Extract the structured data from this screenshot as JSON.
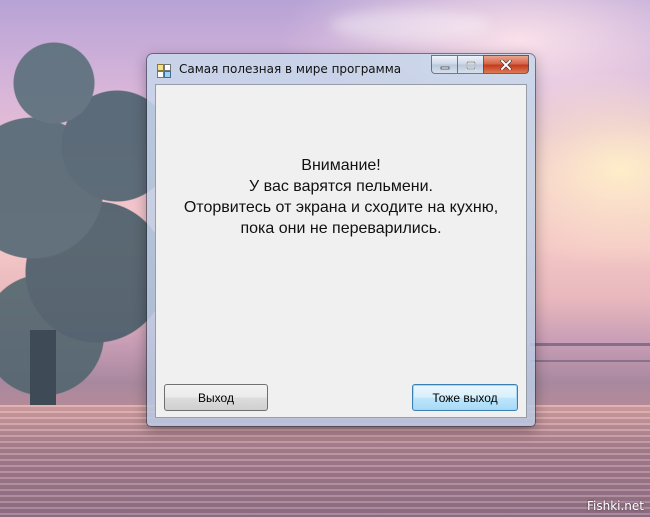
{
  "window": {
    "title": "Самая полезная в мире программа",
    "icon": "app-window-icon"
  },
  "caption_buttons": {
    "minimize_icon": "minimize-icon",
    "maximize_icon": "maximize-icon",
    "close_icon": "close-icon"
  },
  "message": {
    "line1": "Внимание!",
    "line2": "У вас варятся пельмени.",
    "line3": "Оторвитесь от экрана и сходите на кухню,",
    "line4": "пока они не переварились."
  },
  "buttons": {
    "exit_label": "Выход",
    "also_exit_label": "Тоже выход"
  },
  "watermark": "Fishki.net",
  "colors": {
    "client_background": "#f0f0f0",
    "close_button": "#c43b1f",
    "default_button_border": "#3c7fb1"
  }
}
